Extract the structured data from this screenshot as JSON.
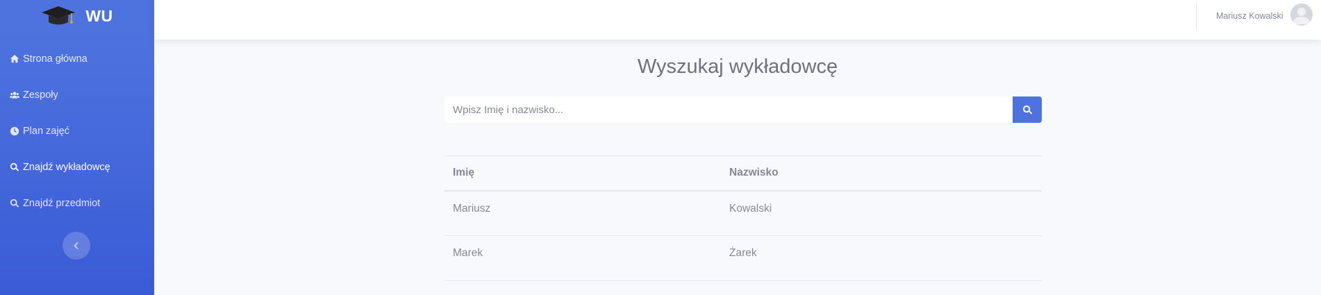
{
  "sidebar": {
    "brand": "WU",
    "items": [
      {
        "label": "Strona główna",
        "icon": "home-icon"
      },
      {
        "label": "Zespoły",
        "icon": "users-icon"
      },
      {
        "label": "Plan zajęć",
        "icon": "clock-icon"
      },
      {
        "label": "Znajdź wykładowcę",
        "icon": "search-icon",
        "active": true
      },
      {
        "label": "Znajdź przedmiot",
        "icon": "search-icon"
      }
    ]
  },
  "topbar": {
    "user_name": "Mariusz Kowalski"
  },
  "main": {
    "title": "Wyszukaj wykładowcę",
    "search": {
      "placeholder": "Wpisz Imię i nazwisko...",
      "value": ""
    },
    "table": {
      "headers": [
        "Imię",
        "Nazwisko"
      ],
      "rows": [
        [
          "Mariusz",
          "Kowalski"
        ],
        [
          "Marek",
          "Żarek"
        ]
      ]
    }
  },
  "colors": {
    "primary": "#4e73df",
    "background": "#f8f9fc",
    "text": "#858796"
  }
}
